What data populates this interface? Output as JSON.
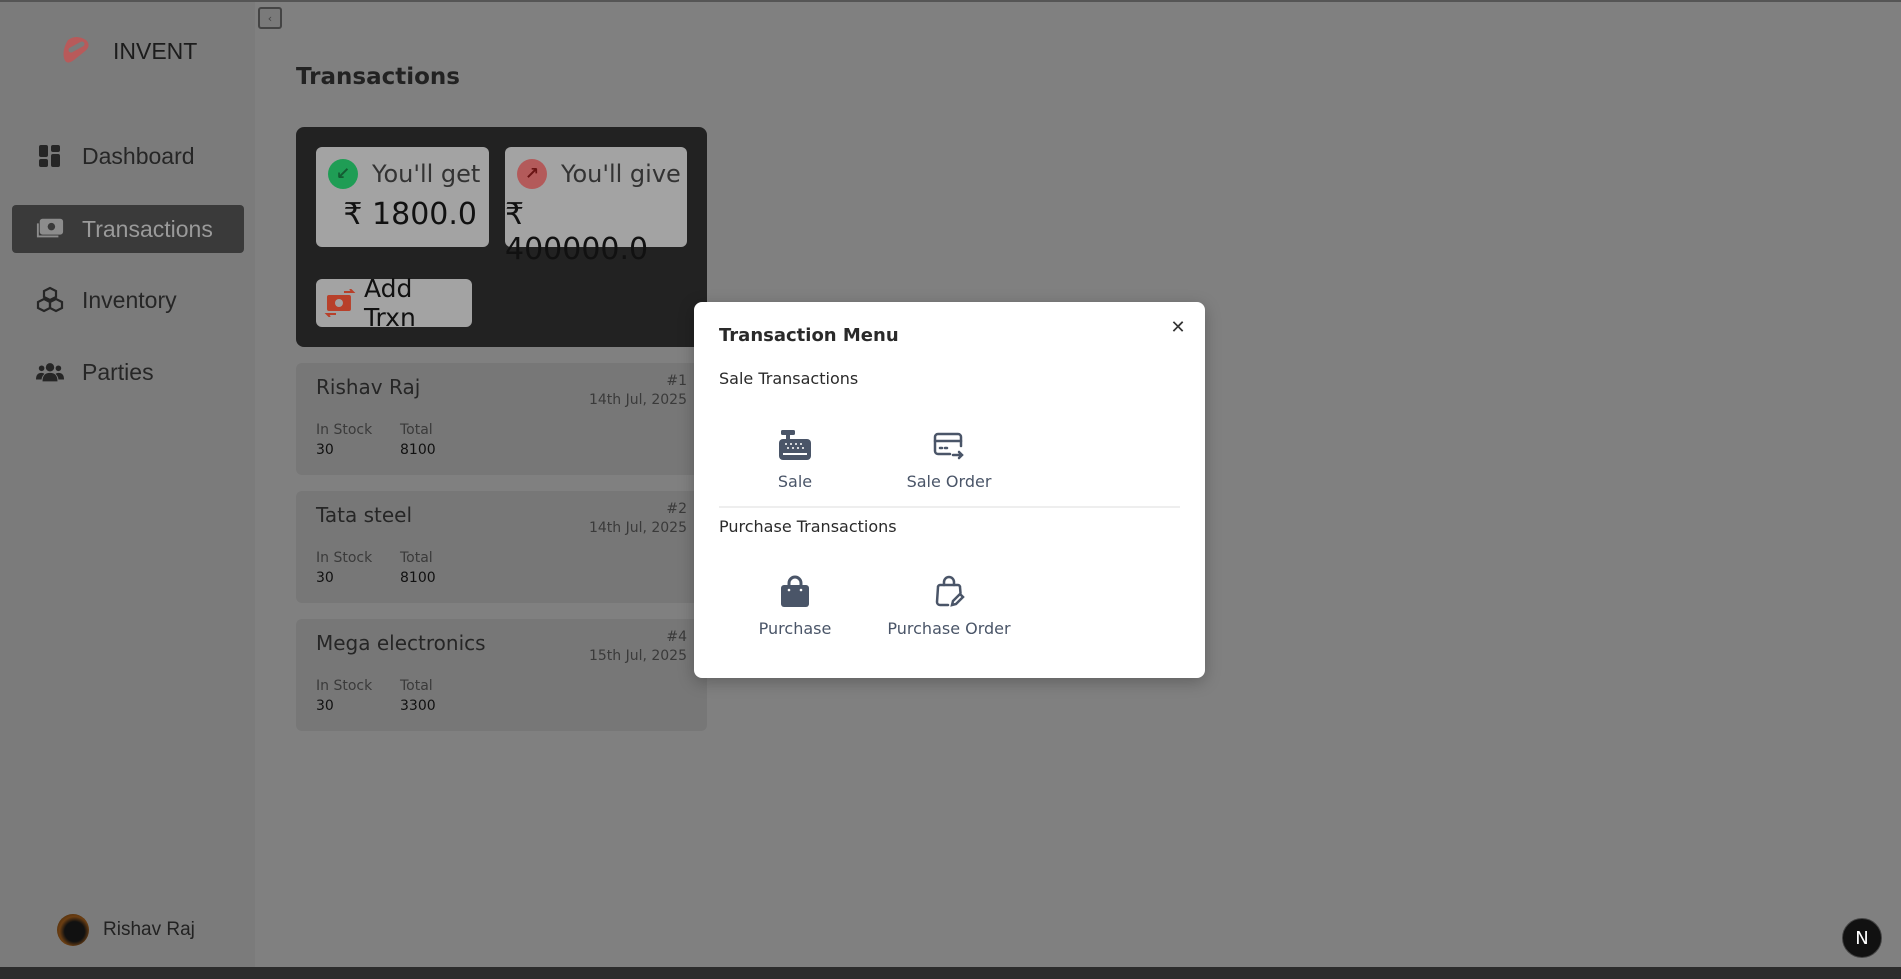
{
  "brand": {
    "name": "INVENT"
  },
  "sidebar": {
    "items": [
      {
        "label": "Dashboard",
        "icon": "dashboard-icon"
      },
      {
        "label": "Transactions",
        "icon": "money-icon",
        "active": true
      },
      {
        "label": "Inventory",
        "icon": "cubes-icon"
      },
      {
        "label": "Parties",
        "icon": "users-icon"
      }
    ]
  },
  "user": {
    "name": "Rishav Raj"
  },
  "page": {
    "title": "Transactions"
  },
  "summary": {
    "get": {
      "label": "You'll get",
      "amount": "₹ 1800.0",
      "color": "#1f9d55"
    },
    "give": {
      "label": "You'll give",
      "amount": "₹ 400000.0",
      "color": "#c0504d"
    },
    "add_label": "Add Trxn"
  },
  "transactions": [
    {
      "name": "Rishav Raj",
      "number": "#1",
      "date": "14th Jul, 2025",
      "stock_label": "In Stock",
      "stock": "30",
      "total_label": "Total",
      "total": "8100"
    },
    {
      "name": "Tata steel",
      "number": "#2",
      "date": "14th Jul, 2025",
      "stock_label": "In Stock",
      "stock": "30",
      "total_label": "Total",
      "total": "8100"
    },
    {
      "name": "Mega electronics",
      "number": "#4",
      "date": "15th Jul, 2025",
      "stock_label": "In Stock",
      "stock": "30",
      "total_label": "Total",
      "total": "3300"
    }
  ],
  "modal": {
    "title": "Transaction Menu",
    "sale_section": "Sale Transactions",
    "sale": "Sale",
    "sale_order": "Sale Order",
    "purchase_section": "Purchase Transactions",
    "purchase": "Purchase",
    "purchase_order": "Purchase Order"
  },
  "badge": {
    "letter": "N"
  }
}
